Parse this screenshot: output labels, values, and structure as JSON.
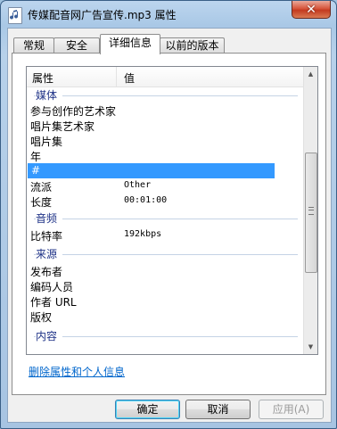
{
  "window": {
    "title": "传媒配音网广告宣传.mp3 属性",
    "close_label": "✕"
  },
  "tabs": [
    {
      "label": "常规",
      "active": false
    },
    {
      "label": "安全",
      "active": false
    },
    {
      "label": "详细信息",
      "active": true
    },
    {
      "label": "以前的版本",
      "active": false
    }
  ],
  "table": {
    "col_property": "属性",
    "col_value": "值",
    "rows": [
      {
        "kind": "group",
        "label": "媒体"
      },
      {
        "kind": "row",
        "prop": "参与创作的艺术家",
        "value": ""
      },
      {
        "kind": "row",
        "prop": "唱片集艺术家",
        "value": ""
      },
      {
        "kind": "row",
        "prop": "唱片集",
        "value": ""
      },
      {
        "kind": "row",
        "prop": "年",
        "value": ""
      },
      {
        "kind": "row",
        "prop": "#",
        "value": "",
        "selected": true
      },
      {
        "kind": "row",
        "prop": "流派",
        "value": "Other"
      },
      {
        "kind": "row",
        "prop": "长度",
        "value": "00:01:00"
      },
      {
        "kind": "group",
        "label": "音频"
      },
      {
        "kind": "row",
        "prop": "比特率",
        "value": "192kbps"
      },
      {
        "kind": "group",
        "label": "来源"
      },
      {
        "kind": "row",
        "prop": "发布者",
        "value": ""
      },
      {
        "kind": "row",
        "prop": "编码人员",
        "value": ""
      },
      {
        "kind": "row",
        "prop": "作者 URL",
        "value": ""
      },
      {
        "kind": "row",
        "prop": "版权",
        "value": ""
      },
      {
        "kind": "group",
        "label": "内容"
      }
    ]
  },
  "scrollbar": {
    "up_icon": "▲",
    "down_icon": "▼"
  },
  "remove_link": "删除属性和个人信息",
  "buttons": {
    "ok": "确定",
    "cancel": "取消",
    "apply": "应用(A)"
  }
}
